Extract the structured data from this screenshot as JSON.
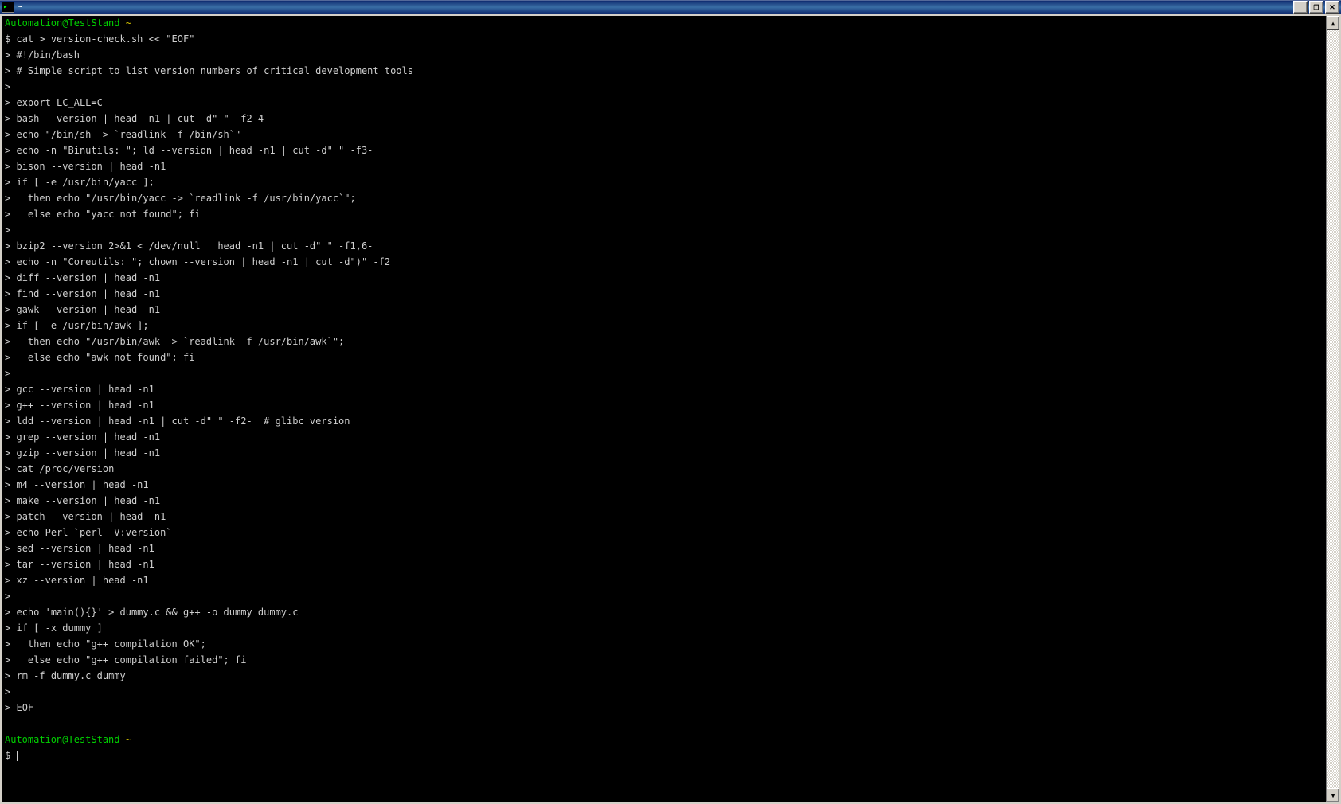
{
  "titlebar": {
    "title": "~"
  },
  "buttons": {
    "minimize": "_",
    "maximize": "❐",
    "close": "✕"
  },
  "scroll": {
    "up": "▲",
    "down": "▼"
  },
  "prompt": {
    "user_host": "Automation@TestStand",
    "path": "~",
    "dollar": "$",
    "gt": ">"
  },
  "cmd": {
    "first": "cat > version-check.sh << \"EOF\""
  },
  "script": {
    "l01": "#!/bin/bash",
    "l02": "# Simple script to list version numbers of critical development tools",
    "l03": "",
    "l04": "export LC_ALL=C",
    "l05": "bash --version | head -n1 | cut -d\" \" -f2-4",
    "l06": "echo \"/bin/sh -> `readlink -f /bin/sh`\"",
    "l07": "echo -n \"Binutils: \"; ld --version | head -n1 | cut -d\" \" -f3-",
    "l08": "bison --version | head -n1",
    "l09": "if [ -e /usr/bin/yacc ];",
    "l10": "  then echo \"/usr/bin/yacc -> `readlink -f /usr/bin/yacc`\";",
    "l11": "  else echo \"yacc not found\"; fi",
    "l12": "",
    "l13": "bzip2 --version 2>&1 < /dev/null | head -n1 | cut -d\" \" -f1,6-",
    "l14": "echo -n \"Coreutils: \"; chown --version | head -n1 | cut -d\")\" -f2",
    "l15": "diff --version | head -n1",
    "l16": "find --version | head -n1",
    "l17": "gawk --version | head -n1",
    "l18": "if [ -e /usr/bin/awk ];",
    "l19": "  then echo \"/usr/bin/awk -> `readlink -f /usr/bin/awk`\";",
    "l20": "  else echo \"awk not found\"; fi",
    "l21": "",
    "l22": "gcc --version | head -n1",
    "l23": "g++ --version | head -n1",
    "l24": "ldd --version | head -n1 | cut -d\" \" -f2-  # glibc version",
    "l25": "grep --version | head -n1",
    "l26": "gzip --version | head -n1",
    "l27": "cat /proc/version",
    "l28": "m4 --version | head -n1",
    "l29": "make --version | head -n1",
    "l30": "patch --version | head -n1",
    "l31": "echo Perl `perl -V:version`",
    "l32": "sed --version | head -n1",
    "l33": "tar --version | head -n1",
    "l34": "xz --version | head -n1",
    "l35": "",
    "l36": "echo 'main(){}' > dummy.c && g++ -o dummy dummy.c",
    "l37": "if [ -x dummy ]",
    "l38": "  then echo \"g++ compilation OK\";",
    "l39": "  else echo \"g++ compilation failed\"; fi",
    "l40": "rm -f dummy.c dummy",
    "l41": "",
    "l42": "EOF"
  }
}
